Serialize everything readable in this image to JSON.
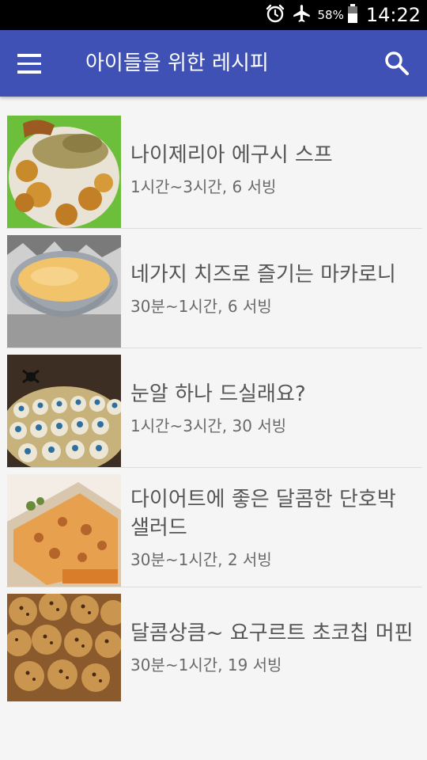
{
  "status": {
    "battery": "58%",
    "time": "14:22"
  },
  "appbar": {
    "title": "아이들을 위한 레시피"
  },
  "recipes": [
    {
      "title": "나이제리아 에구시 스프",
      "meta": "1시간~3시간, 6 서빙"
    },
    {
      "title": "네가지 치즈로 즐기는 마카로니",
      "meta": "30분~1시간, 6 서빙"
    },
    {
      "title": "눈알 하나 드실래요?",
      "meta": "1시간~3시간, 30 서빙"
    },
    {
      "title": "다이어트에 좋은 달콤한 단호박 샐러드",
      "meta": "30분~1시간, 2 서빙"
    },
    {
      "title": "달콤상큼~ 요구르트 초코칩 머핀",
      "meta": "30분~1시간, 19 서빙"
    }
  ],
  "icons": {
    "menu": "hamburger-menu-icon",
    "search": "search-icon",
    "alarm": "alarm-icon",
    "airplane": "airplane-mode-icon",
    "battery": "battery-icon"
  },
  "colors": {
    "appbar": "#3f51b5",
    "statusbar": "#000000",
    "background": "#f5f5f5"
  }
}
